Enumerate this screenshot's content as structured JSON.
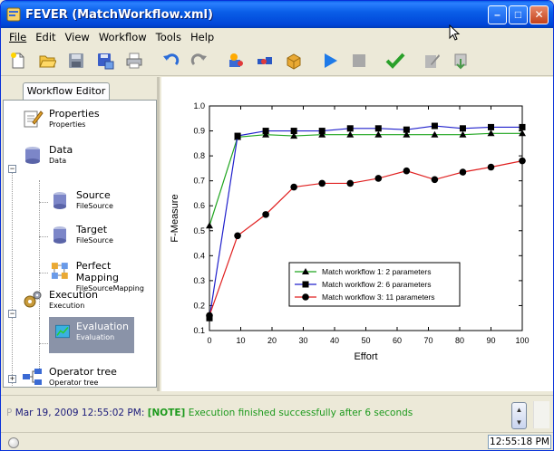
{
  "window": {
    "title": "FEVER (MatchWorkflow.xml)"
  },
  "menubar": {
    "items": [
      "File",
      "Edit",
      "View",
      "Workflow",
      "Tools",
      "Help"
    ]
  },
  "toolbar": {
    "buttons": [
      "new-icon",
      "open-icon",
      "save-icon",
      "save-as-icon",
      "print-icon",
      "undo-icon",
      "redo-icon",
      "add-source-icon",
      "add-mapping-icon",
      "add-package-icon",
      "run-icon",
      "stop-icon",
      "validate-icon",
      "edit-icon",
      "export-icon"
    ]
  },
  "left_panel": {
    "tab_label": "Workflow Editor",
    "tree": [
      {
        "label": "Properties",
        "sub": "Properties",
        "icon": "properties-icon"
      },
      {
        "label": "Data",
        "sub": "Data",
        "icon": "database-icon"
      },
      {
        "label": "Source",
        "sub": "FileSource",
        "icon": "database-icon"
      },
      {
        "label": "Target",
        "sub": "FileSource",
        "icon": "database-icon"
      },
      {
        "label": "Perfect Mapping",
        "sub": "FileSourceMapping",
        "icon": "mapping-icon"
      },
      {
        "label": "Execution",
        "sub": "Execution",
        "icon": "gears-icon"
      },
      {
        "label": "Evaluation",
        "sub": "Evaluation",
        "icon": "chart-icon"
      },
      {
        "label": "Operator tree",
        "sub": "Operator tree",
        "icon": "operator-tree-icon"
      }
    ],
    "expander_minus": "−",
    "expander_plus": "+"
  },
  "colors": {
    "series1": "#1fa51f",
    "series2": "#2020cc",
    "series3": "#e02020"
  },
  "chart_data": {
    "type": "line",
    "xlabel": "Effort",
    "ylabel": "F-Measure",
    "xlim": [
      0,
      100
    ],
    "ylim": [
      0.1,
      1.0
    ],
    "xticks": [
      0,
      10,
      20,
      30,
      40,
      50,
      60,
      70,
      80,
      90,
      100
    ],
    "yticks": [
      0.1,
      0.2,
      0.3,
      0.4,
      0.5,
      0.6,
      0.7,
      0.8,
      0.9,
      1.0
    ],
    "legend_position": "bottom-right",
    "series": [
      {
        "name": "Match workflow 1: 2 parameters",
        "marker": "triangle",
        "x": [
          0,
          9,
          18,
          27,
          36,
          45,
          54,
          63,
          72,
          81,
          90,
          100
        ],
        "y": [
          0.52,
          0.875,
          0.885,
          0.88,
          0.885,
          0.885,
          0.885,
          0.885,
          0.885,
          0.885,
          0.89,
          0.89
        ]
      },
      {
        "name": "Match workflow 2: 6 parameters",
        "marker": "square",
        "x": [
          0,
          9,
          18,
          27,
          36,
          45,
          54,
          63,
          72,
          81,
          90,
          100
        ],
        "y": [
          0.15,
          0.88,
          0.9,
          0.9,
          0.9,
          0.91,
          0.91,
          0.905,
          0.92,
          0.91,
          0.915,
          0.915
        ]
      },
      {
        "name": "Match workflow 3: 11 parameters",
        "marker": "circle",
        "x": [
          0,
          9,
          18,
          27,
          36,
          45,
          54,
          63,
          72,
          81,
          90,
          100
        ],
        "y": [
          0.16,
          0.48,
          0.565,
          0.675,
          0.69,
          0.69,
          0.71,
          0.74,
          0.705,
          0.735,
          0.755,
          0.78
        ]
      }
    ]
  },
  "log": {
    "prefix": "P",
    "timestamp": "Mar 19, 2009 12:55:02 PM:",
    "tag": "[NOTE]",
    "message": "Execution finished successfully after 6 seconds"
  },
  "statusbar": {
    "time": "12:55:18 PM"
  }
}
